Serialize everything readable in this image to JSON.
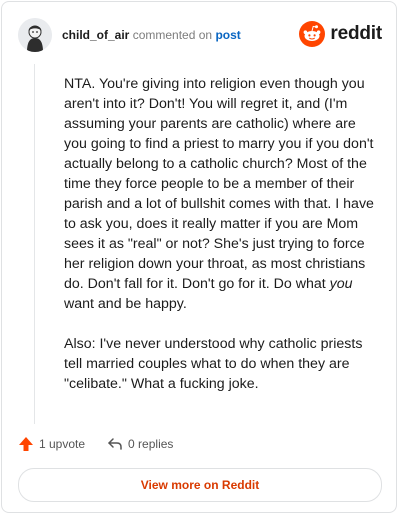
{
  "header": {
    "username": "child_of_air",
    "commented_text": "commented on",
    "post_link": "post",
    "logo_text": "reddit"
  },
  "comment": {
    "paragraph1_a": "NTA. You're giving into religion even though you aren't into it? Don't! You will regret it, and (I'm assuming your parents are catholic) where are you going to find a priest to marry you if you don't actually belong to a catholic church? Most of the time they force people to be a member of their parish and a lot of bullshit comes with that. I have to ask you, does it really matter if you are Mom sees it as \"real\" or not? She's just trying to force her religion down your throat, as most christians do. Don't fall for it. Don't go for it. Do what ",
    "paragraph1_em": "you",
    "paragraph1_b": " want and be happy.",
    "paragraph2": "Also: I've never understood why catholic priests tell married couples what to do when they are \"celibate.\" What a fucking joke."
  },
  "actions": {
    "upvotes": "1 upvote",
    "replies": "0 replies"
  },
  "footer": {
    "view_more": "View more on Reddit"
  },
  "colors": {
    "accent": "#d93a00",
    "upvote": "#ff4500",
    "link": "#0a66c2"
  }
}
